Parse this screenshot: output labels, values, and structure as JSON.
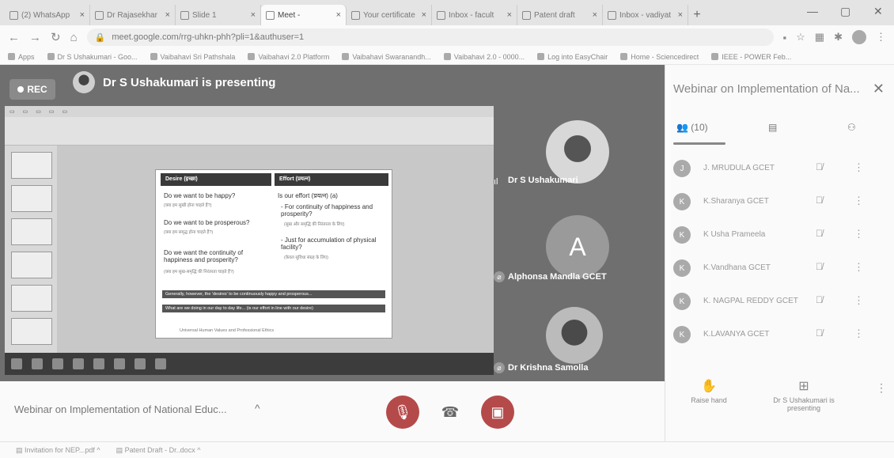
{
  "browser": {
    "tabs": [
      {
        "label": "(2) WhatsApp"
      },
      {
        "label": "Dr Rajasekhar"
      },
      {
        "label": "Slide 1"
      },
      {
        "label": "Meet - "
      },
      {
        "label": "Your certificate"
      },
      {
        "label": "Inbox - facult"
      },
      {
        "label": "Patent draft"
      },
      {
        "label": "Inbox - vadiyat"
      }
    ],
    "url": "meet.google.com/rrg-uhkn-phh?pli=1&authuser=1",
    "bookmarks": [
      "Apps",
      "Dr S Ushakumari - Goo...",
      "Vaibahavi Sri Pathshala",
      "Vaibahavi 2.0 Platform",
      "Vaibahavi Swaranandh...",
      "Vaibahavi 2.0 - 0000...",
      "Log into EasyChair",
      "Home - Sciencedirect",
      "IEEE - POWER Feb..."
    ]
  },
  "meet": {
    "rec_label": "REC",
    "presenting_text": "Dr S Ushakumari is presenting",
    "meeting_title": "Webinar on Implementation of National Educ...",
    "participants": [
      {
        "name": "Dr S Ushakumari"
      },
      {
        "name": "Alphonsa Mandla GCET",
        "initial": "A"
      },
      {
        "name": "Dr Krishna Samolla"
      }
    ]
  },
  "slide": {
    "col1_head": "Desire (इच्छा)",
    "col2_head": "Effort (प्रयत्न)",
    "q1": "Do we want to be happy?",
    "q1_sub": "(क्या हम सुखी होना चाहते हैं?)",
    "q2": "Do we want to be prosperous?",
    "q2_sub": "(क्या हम समृद्ध होना चाहते हैं?)",
    "q3": "Do we want the continuity of happiness and prosperity?",
    "q3_sub": "(क्या हम सुख-समृद्धि की निरंतरता चाहते हैं?)",
    "e1": "Is our effort (प्रयत्न) (a)",
    "e2": "- For continuity of happiness and prosperity?",
    "e2_sub": "(सुख और समृद्धि की निरंतरता के लिए)",
    "e3": "- Just for accumulation of physical facility?",
    "e3_sub": "(केवल सुविधा संग्रह के लिए)",
    "note1": "Generally, however, the 'desires' to be continuously happy and prosperous...",
    "note2": "What are we doing in our day to day life... (is our effort in line with our desire)",
    "footer": "Universal Human Values and Professional Ethics"
  },
  "panel": {
    "title": "Webinar on Implementation of Na...",
    "tab_people": "(10)",
    "people": [
      {
        "initial": "J",
        "name": "J. MRUDULA GCET"
      },
      {
        "initial": "K",
        "name": "K.Sharanya GCET"
      },
      {
        "initial": "K",
        "name": "K Usha Prameela"
      },
      {
        "initial": "K",
        "name": "K.Vandhana GCET"
      },
      {
        "initial": "K",
        "name": "K. NAGPAL REDDY GCET"
      },
      {
        "initial": "K",
        "name": "K.LAVANYA GCET"
      }
    ],
    "raise_hand": "Raise hand",
    "presenting_now": "Dr S Ushakumari is presenting"
  },
  "downloads": [
    {
      "name": "Invitation for NEP...pdf"
    },
    {
      "name": "Patent Draft - Dr..docx"
    }
  ],
  "colors": {
    "stage_bg": "#6f6f6f",
    "rec_bg": "#8a8a8a",
    "control_red": "#b54a4a"
  }
}
